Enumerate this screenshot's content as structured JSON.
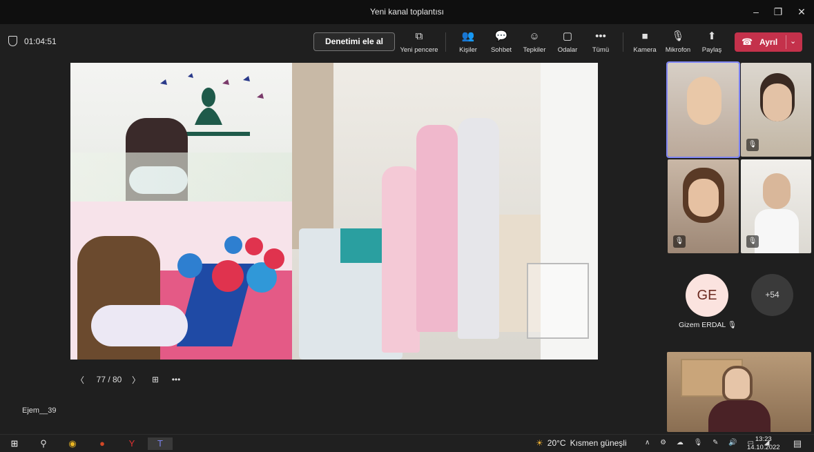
{
  "window": {
    "title": "Yeni kanal toplantısı",
    "minimize_icon": "minimize-icon",
    "maximize_icon": "restore-icon",
    "close_icon": "close-icon"
  },
  "toolbar": {
    "timer": "01:04:51",
    "take_control": "Denetimi ele al",
    "buttons": [
      {
        "label": "Yeni pencere",
        "icon": "popout-icon"
      },
      {
        "label": "Kişiler",
        "icon": "people-icon"
      },
      {
        "label": "Sohbet",
        "icon": "chat-icon"
      },
      {
        "label": "Tepkiler",
        "icon": "reactions-icon"
      },
      {
        "label": "Odalar",
        "icon": "rooms-icon"
      },
      {
        "label": "Tümü",
        "icon": "more-icon"
      },
      {
        "label": "Kamera",
        "icon": "camera-icon"
      },
      {
        "label": "Mikrofon",
        "icon": "mic-off-icon"
      },
      {
        "label": "Paylaş",
        "icon": "share-icon"
      }
    ],
    "leave": "Ayrıl"
  },
  "presentation": {
    "pager": "77 / 80"
  },
  "self_name": "Ejem__39",
  "participants": {
    "avatar_initials": "GE",
    "avatar_name": "Gizem ERDAL",
    "overflow": "+54"
  },
  "taskbar": {
    "weather_temp": "20°C",
    "weather_text": "Kısmen güneşli",
    "time": "13:23",
    "date": "14.10.2022"
  }
}
